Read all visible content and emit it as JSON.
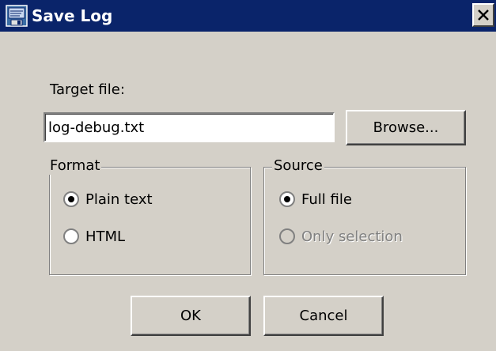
{
  "window": {
    "title": "Save Log",
    "close_glyph": "X",
    "icon": "save-log-app-icon",
    "titlebar_color": "#0a246a",
    "face_color": "#d4d0c8"
  },
  "target": {
    "label": "Target file:",
    "value": "log-debug.txt",
    "browse_label": "Browse..."
  },
  "format": {
    "title": "Format",
    "options": [
      {
        "label": "Plain text",
        "selected": true,
        "enabled": true
      },
      {
        "label": "HTML",
        "selected": false,
        "enabled": true
      }
    ]
  },
  "source": {
    "title": "Source",
    "options": [
      {
        "label": "Full file",
        "selected": true,
        "enabled": true
      },
      {
        "label": "Only selection",
        "selected": false,
        "enabled": false
      }
    ]
  },
  "buttons": {
    "ok": "OK",
    "cancel": "Cancel"
  }
}
